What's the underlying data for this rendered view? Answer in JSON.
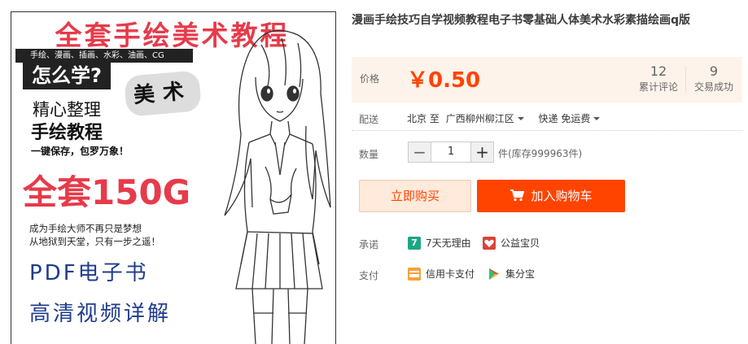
{
  "product_image": {
    "title": "全套手绘美术教程",
    "categories": "手绘、漫画、插画、水彩、油画、CG",
    "how": "怎么学?",
    "seal": "美术",
    "line1": "精心整理",
    "line2": "手绘教程",
    "line3": "一键保存，包罗万象！",
    "big": "全套150G",
    "dream1": "成为手绘大师不再只是梦想",
    "dream2": "从地狱到天堂，只有一步之遥！",
    "pdf": "PDF电子书",
    "video": "高清视频详解"
  },
  "product": {
    "title": "漫画手绘技巧自学视频教程电子书零基础人体美术水彩素描绘画q版"
  },
  "price": {
    "label": "价格",
    "value": "￥0.50",
    "reviews_count": "12",
    "reviews_label": "累计评论",
    "deals_count": "9",
    "deals_label": "交易成功"
  },
  "shipping": {
    "label": "配送",
    "from": "北京",
    "to_word": "至",
    "destination": "广西柳州柳江区",
    "method": "快递 免运费"
  },
  "quantity": {
    "label": "数量",
    "minus": "−",
    "value": "1",
    "plus": "+",
    "stock": "件(库存999963件)"
  },
  "actions": {
    "buy_now": "立即购买",
    "add_cart": "加入购物车"
  },
  "promise": {
    "label": "承诺",
    "item1": "7天无理由",
    "item2": "公益宝贝"
  },
  "payment": {
    "label": "支付",
    "item1": "信用卡支付",
    "item2": "集分宝"
  },
  "colors": {
    "accent": "#ff4400",
    "price_bg": "#fef3eb",
    "ad_red": "#e63b4a",
    "ad_blue": "#1f3c8c"
  }
}
